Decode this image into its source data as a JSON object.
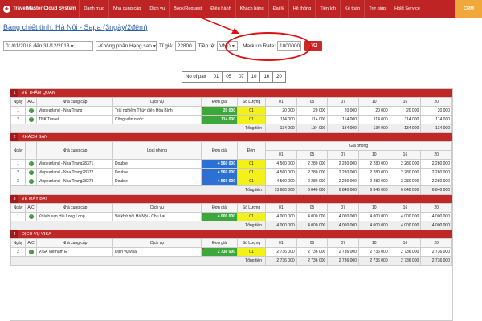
{
  "nav": {
    "brand": "TravelMaster Cloud System",
    "items": [
      "Danh mục",
      "Nhà cung cấp",
      "Dịch vụ",
      "Book/Request",
      "Điều hành",
      "Khách hàng",
      "Đại lý",
      "Hệ thống",
      "Tiện ích",
      "Kế toán",
      "Trợ giúp",
      "Hold Service"
    ],
    "crm": "CRM"
  },
  "title": "Bảng chiết tính: Hà Nội - Sapa (3ngày/2đêm)",
  "filters": {
    "date_range": "01/01/2018 đến 31/12/2018",
    "hang_sao": "-Không phân Hạng sao",
    "ti_gia_label": "Tỉ giá:",
    "ti_gia": "22800",
    "tien_te_label": "Tiền tệ:",
    "tien_te": "VND",
    "markup_label": "Mark up Rate:",
    "markup": "1000000",
    "go": "GO"
  },
  "pax": {
    "label": "No of pax",
    "values": [
      "01",
      "05",
      "07",
      "10",
      "16",
      "20"
    ]
  },
  "sections": {
    "s1": {
      "num": "1",
      "title": "VÉ THĂM QUAN",
      "headers": [
        "Ngày",
        "A/C",
        "Nhà cung cấp",
        "Dịch vụ",
        "Đơn giá",
        "Số Lượng",
        "01",
        "05",
        "07",
        "10",
        "16",
        "20"
      ],
      "rows": [
        {
          "day": "1",
          "ncc": "Vinpearland - Nha Trang",
          "dv": "Trải nghiệm Thủy điện Hòa Bình",
          "price": "20 000",
          "qty": "01",
          "v": [
            "20 000",
            "20 000",
            "20 000",
            "20 000",
            "20 000",
            "20 000"
          ]
        },
        {
          "day": "2",
          "ncc": "TNK Travel",
          "dv": "Công viên nước",
          "price": "114 000",
          "qty": "01",
          "v": [
            "114 000",
            "114 000",
            "114 000",
            "114 000",
            "114 000",
            "114 000"
          ]
        }
      ],
      "total_label": "Tổng tiền",
      "totals": [
        "134 000",
        "134 000",
        "134 000",
        "134 000",
        "134 000",
        "134 000"
      ]
    },
    "s2": {
      "num": "2",
      "title": "KHÁCH SẠN",
      "headers": [
        "Ngày",
        "-",
        "Nhà cung cấp",
        "Loại phòng",
        "Đơn giá",
        "Đêm",
        "01",
        "05",
        "07",
        "10",
        "16",
        "20"
      ],
      "group": "Giá phòng",
      "rows": [
        {
          "day": "1",
          "ncc": "Vinpearland - Nha Trang28371",
          "dv": "Double",
          "price": "4 560 000",
          "qty": "01",
          "v": [
            "4 560 000",
            "2 280 000",
            "2 280 000",
            "2 280 000",
            "2 280 000",
            "2 280 000"
          ]
        },
        {
          "day": "2",
          "ncc": "Vinpearland - Nha Trang28372",
          "dv": "Double",
          "price": "4 560 000",
          "qty": "01",
          "v": [
            "4 560 000",
            "2 280 000",
            "2 280 000",
            "2 280 000",
            "2 280 000",
            "2 280 000"
          ]
        },
        {
          "day": "3",
          "ncc": "Vinpearland - Nha Trang28373",
          "dv": "Double",
          "price": "4 560 000",
          "qty": "01",
          "v": [
            "4 560 000",
            "2 280 000",
            "2 280 000",
            "2 280 000",
            "2 280 000",
            "2 280 000"
          ]
        }
      ],
      "total_label": "Tổng tiền",
      "totals": [
        "13 680 000",
        "6 840 000",
        "6 840 000",
        "6 840 000",
        "6 840 000",
        "6 840 000"
      ]
    },
    "s3": {
      "num": "3",
      "title": "VÉ MÁY BAY",
      "headers": [
        "Ngày",
        "A/C",
        "Nhà cung cấp",
        "Dịch vụ",
        "Đơn giá",
        "Số Lượng",
        "01",
        "05",
        "07",
        "10",
        "16",
        "20"
      ],
      "rows": [
        {
          "day": "1",
          "ncc": "Khách sạn Hải Long Long",
          "dv": "Vé khứ hồi Hà Nội - Chu Lai",
          "price": "4 000 000",
          "qty": "01",
          "v": [
            "4 000 000",
            "4 000 000",
            "4 000 000",
            "4 000 000",
            "4 000 000",
            "4 000 000"
          ]
        }
      ],
      "total_label": "Tổng tiền",
      "totals": [
        "4 000 000",
        "4 000 000",
        "4 000 000",
        "4 000 000",
        "4 000 000",
        "4 000 000"
      ]
    },
    "s4": {
      "num": "4",
      "title": "DỊCH VỤ VISA",
      "headers": [
        "Ngày",
        "A/C",
        "Nhà cung cấp",
        "Dịch vụ",
        "Đơn giá",
        "Số Lượng",
        "01",
        "05",
        "07",
        "10",
        "16",
        "20"
      ],
      "rows": [
        {
          "day": "2",
          "ncc": "VISA Vietnam E",
          "dv": "Dịch vụ visa",
          "price": "2 736 000",
          "qty": "01",
          "v": [
            "2 736 000",
            "2 736 000",
            "2 736 000",
            "2 736 000",
            "2 736 000",
            "2 736 000"
          ]
        }
      ],
      "total_label": "Tổng tiền",
      "totals": [
        "2 736 000",
        "2 736 000",
        "2 736 000",
        "2 736 000",
        "2 736 000",
        "2 736 000"
      ]
    }
  },
  "colors": {
    "nav": "#bf2424",
    "crm": "#f0a83a",
    "price_green": "#3ca83c",
    "price_blue": "#2b71d4",
    "qty_yellow": "#f4f01a",
    "highlight": "#dd1111"
  },
  "icons": {
    "ok": "check-circle-icon",
    "brand": "logo-icon"
  }
}
